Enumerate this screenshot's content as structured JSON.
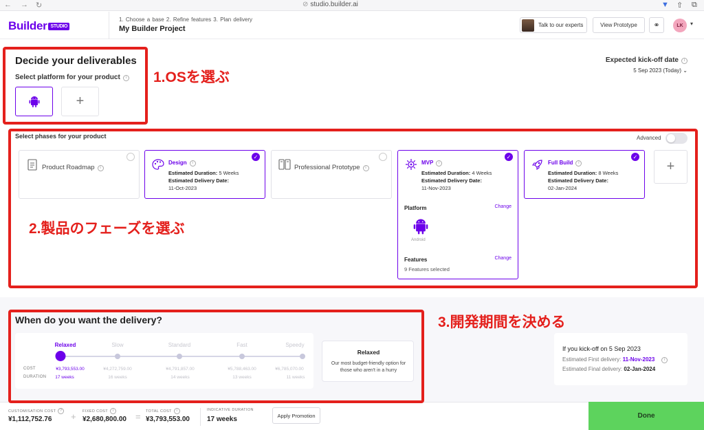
{
  "browser": {
    "url": "studio.builder.ai"
  },
  "header": {
    "logo_text": "Builder",
    "logo_badge": "STUDIO",
    "steps": "1. Choose a base   2. Refine features   3. Plan delivery",
    "project_name": "My Builder Project",
    "talk_label": "Talk to our experts",
    "prototype_label": "View Prototype",
    "user_initials": "LK"
  },
  "deliverables": {
    "title": "Decide your deliverables",
    "platform_label": "Select platform for your product"
  },
  "kickoff": {
    "label": "Expected kick-off date",
    "date": "5 Sep 2023 (Today)"
  },
  "phases": {
    "label": "Select phases for your product",
    "advanced_label": "Advanced",
    "roadmap": {
      "name": "Product Roadmap"
    },
    "design": {
      "name": "Design",
      "duration_label": "Estimated Duration:",
      "duration": "5 Weeks",
      "delivery_label": "Estimated Delivery Date:",
      "delivery": "11-Oct-2023"
    },
    "prototype": {
      "name": "Professional Prototype"
    },
    "mvp": {
      "name": "MVP",
      "duration_label": "Estimated Duration:",
      "duration": "4 Weeks",
      "delivery_label": "Estimated Delivery Date:",
      "delivery": "11-Nov-2023",
      "platform_label": "Platform",
      "change_label": "Change",
      "platform_name": "Android",
      "features_label": "Features",
      "features_change": "Change",
      "features_count": "9 Features selected"
    },
    "fullbuild": {
      "name": "Full Build",
      "duration_label": "Estimated Duration:",
      "duration": "8 Weeks",
      "delivery_label": "Estimated Delivery Date:",
      "delivery": "02-Jan-2024"
    }
  },
  "annotations": {
    "a1": "1.OSを選ぶ",
    "a2": "2.製品のフェーズを選ぶ",
    "a3": "3.開発期間を決める"
  },
  "delivery": {
    "title": "When do you want the delivery?",
    "cost_label": "COST",
    "duration_label": "DURATION",
    "speeds": [
      {
        "name": "Relaxed",
        "cost": "¥3,793,553.00",
        "duration": "17 weeks"
      },
      {
        "name": "Slow",
        "cost": "¥4,272,759.00",
        "duration": "16 weeks"
      },
      {
        "name": "Standard",
        "cost": "¥4,791,857.00",
        "duration": "14 weeks"
      },
      {
        "name": "Fast",
        "cost": "¥5,788,463.00",
        "duration": "13 weeks"
      },
      {
        "name": "Speedy",
        "cost": "¥6,785,070.00",
        "duration": "11 weeks"
      }
    ],
    "selected_title": "Relaxed",
    "selected_desc": "Our most budget-friendly option for those who aren't in a hurry"
  },
  "kickoff_summary": {
    "title": "If you kick-off on 5 Sep 2023",
    "first_label": "Estimated First delivery:",
    "first_date": "11-Nov-2023",
    "final_label": "Estimated Final delivery:",
    "final_date": "02-Jan-2024"
  },
  "footer": {
    "custom_label": "CUSTOMISATION COST",
    "custom_value": "¥1,112,752.76",
    "fixed_label": "FIXED COST",
    "fixed_value": "¥2,680,800.00",
    "total_label": "TOTAL COST",
    "total_value": "¥3,793,553.00",
    "duration_label": "INDICATIVE DURATION",
    "duration_value": "17 weeks",
    "promo_label": "Apply Promotion",
    "done_label": "Done"
  },
  "colors": {
    "brand": "#6c00ea",
    "annotation": "#e4201c",
    "done": "#5dd35d"
  }
}
